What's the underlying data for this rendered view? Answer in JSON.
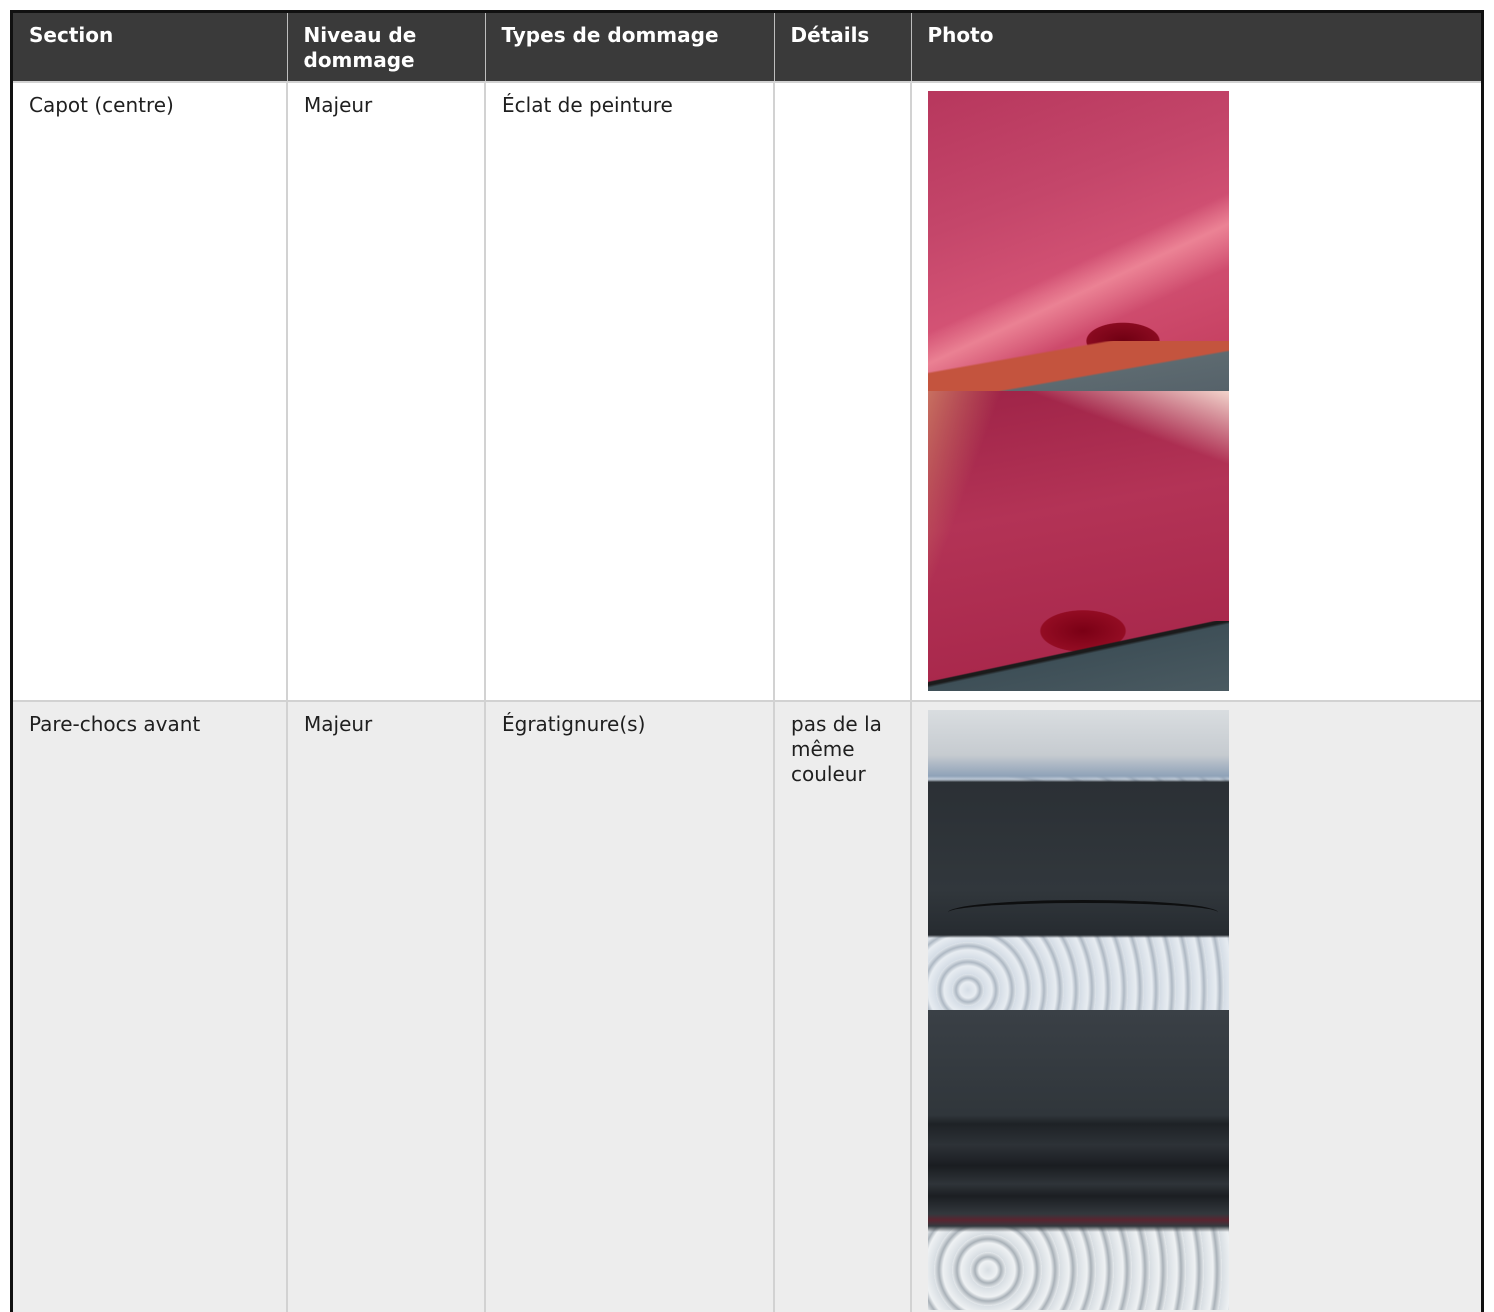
{
  "table": {
    "headers": [
      "Section",
      "Niveau de dommage",
      "Types de dommage",
      "Détails",
      "Photo"
    ],
    "rows": [
      {
        "section": "Capot (centre)",
        "niveau": "Majeur",
        "types": "Éclat de peinture",
        "details": "",
        "photos": [
          "photo-hood-1",
          "photo-hood-2"
        ]
      },
      {
        "section": "Pare-chocs avant",
        "niveau": "Majeur",
        "types": "Égratignure(s)",
        "details": "pas de la même couleur",
        "photos": [
          "photo-bumper-1",
          "photo-bumper-2"
        ]
      }
    ]
  },
  "colors": {
    "header_bg": "#3a3a3a",
    "row_alt_bg": "#ededed",
    "border": "#d2d2d2"
  }
}
